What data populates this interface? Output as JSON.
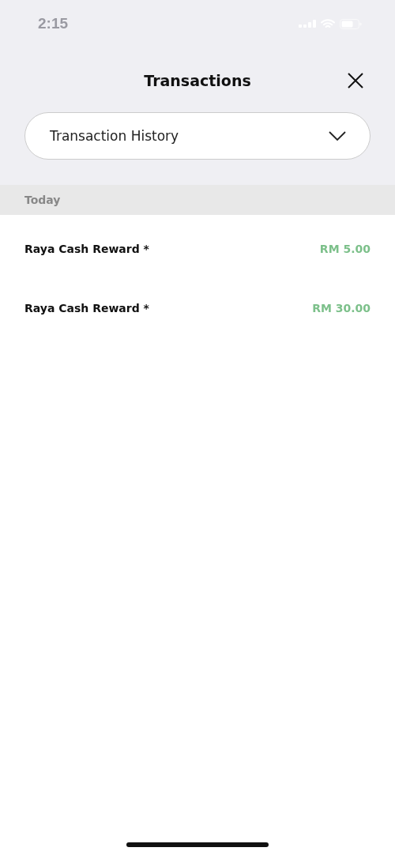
{
  "status_bar": {
    "time": "2:15"
  },
  "header": {
    "title": "Transactions"
  },
  "dropdown": {
    "value": "Transaction History"
  },
  "sections": [
    {
      "title": "Today",
      "rows": [
        {
          "name": "Raya Cash Reward *",
          "amount": "RM 5.00"
        },
        {
          "name": "Raya Cash Reward *",
          "amount": "RM 30.00"
        }
      ]
    }
  ]
}
